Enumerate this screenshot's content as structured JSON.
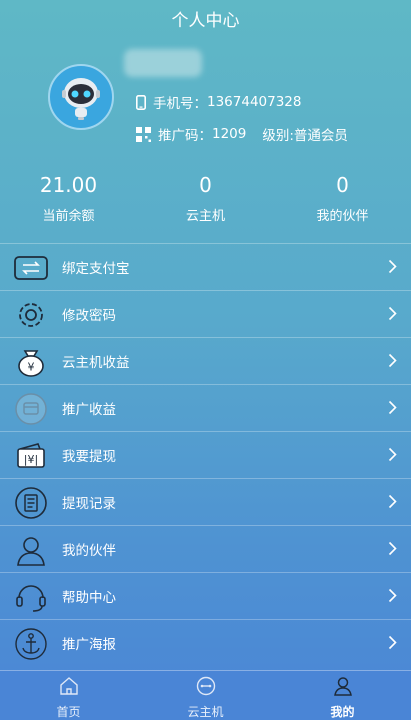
{
  "header": {
    "title": "个人中心"
  },
  "profile": {
    "phone_label": "手机号：",
    "phone": "13674407328",
    "promo_label": "推广码：",
    "promo_code": "1209",
    "level_label": "级别:",
    "level": "普通会员"
  },
  "stats": [
    {
      "value": "21.00",
      "label": "当前余额"
    },
    {
      "value": "0",
      "label": "云主机"
    },
    {
      "value": "0",
      "label": "我的伙伴"
    }
  ],
  "menu": [
    {
      "label": "绑定支付宝",
      "icon": "bind-alipay-icon"
    },
    {
      "label": "修改密码",
      "icon": "gear-icon"
    },
    {
      "label": "云主机收益",
      "icon": "money-bag-icon"
    },
    {
      "label": "推广收益",
      "icon": "promo-income-icon"
    },
    {
      "label": "我要提现",
      "icon": "wallet-icon"
    },
    {
      "label": "提现记录",
      "icon": "record-icon"
    },
    {
      "label": "我的伙伴",
      "icon": "user-icon"
    },
    {
      "label": "帮助中心",
      "icon": "headset-icon"
    },
    {
      "label": "推广海报",
      "icon": "anchor-icon"
    }
  ],
  "tabbar": [
    {
      "label": "首页",
      "icon": "home-icon",
      "active": false
    },
    {
      "label": "云主机",
      "icon": "cloud-host-icon",
      "active": false
    },
    {
      "label": "我的",
      "icon": "user-icon",
      "active": true
    }
  ]
}
